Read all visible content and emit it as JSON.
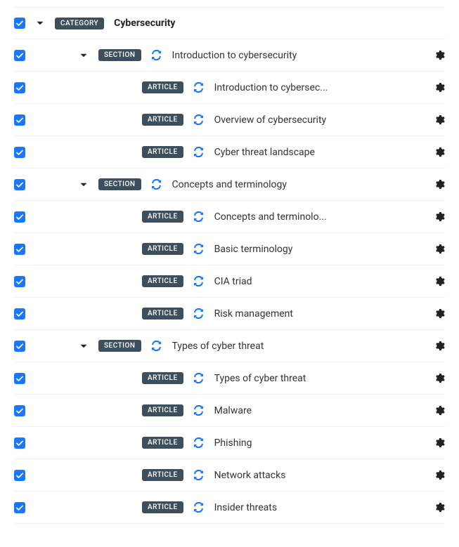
{
  "badges": {
    "category": "CATEGORY",
    "section": "SECTION",
    "article": "ARTICLE"
  },
  "rows": [
    {
      "level": 0,
      "type": "category",
      "label": "Cybersecurity",
      "bold": true,
      "chevron": true,
      "sync": false,
      "gear": false
    },
    {
      "level": 1,
      "type": "section",
      "label": "Introduction to cybersecurity",
      "chevron": true,
      "sync": true,
      "gear": true
    },
    {
      "level": 2,
      "type": "article",
      "label": "Introduction to cybersec...",
      "chevron": false,
      "sync": true,
      "gear": true
    },
    {
      "level": 2,
      "type": "article",
      "label": "Overview of cybersecurity",
      "chevron": false,
      "sync": true,
      "gear": true
    },
    {
      "level": 2,
      "type": "article",
      "label": "Cyber threat landscape",
      "chevron": false,
      "sync": true,
      "gear": true
    },
    {
      "level": 1,
      "type": "section",
      "label": "Concepts and terminology",
      "chevron": true,
      "sync": true,
      "gear": true
    },
    {
      "level": 2,
      "type": "article",
      "label": "Concepts and terminolo...",
      "chevron": false,
      "sync": true,
      "gear": true
    },
    {
      "level": 2,
      "type": "article",
      "label": "Basic terminology",
      "chevron": false,
      "sync": true,
      "gear": true
    },
    {
      "level": 2,
      "type": "article",
      "label": "CIA triad",
      "chevron": false,
      "sync": true,
      "gear": true
    },
    {
      "level": 2,
      "type": "article",
      "label": "Risk management",
      "chevron": false,
      "sync": true,
      "gear": true
    },
    {
      "level": 1,
      "type": "section",
      "label": "Types of cyber threat",
      "chevron": true,
      "sync": true,
      "gear": true
    },
    {
      "level": 2,
      "type": "article",
      "label": "Types of cyber threat",
      "chevron": false,
      "sync": true,
      "gear": true
    },
    {
      "level": 2,
      "type": "article",
      "label": "Malware",
      "chevron": false,
      "sync": true,
      "gear": true
    },
    {
      "level": 2,
      "type": "article",
      "label": "Phishing",
      "chevron": false,
      "sync": true,
      "gear": true
    },
    {
      "level": 2,
      "type": "article",
      "label": "Network attacks",
      "chevron": false,
      "sync": true,
      "gear": true
    },
    {
      "level": 2,
      "type": "article",
      "label": "Insider threats",
      "chevron": false,
      "sync": true,
      "gear": true
    }
  ]
}
